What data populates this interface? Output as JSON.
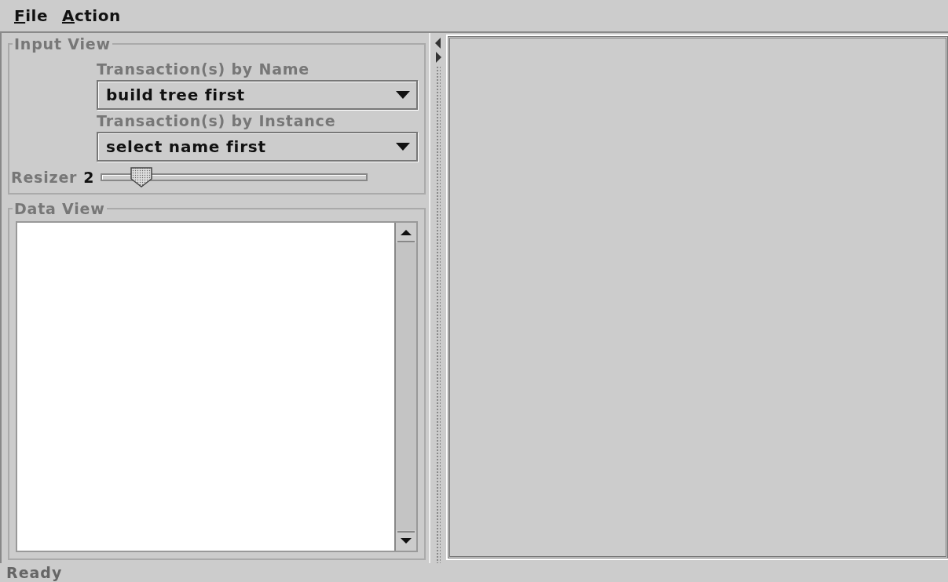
{
  "menu_bar": {
    "items": [
      {
        "label": "File"
      },
      {
        "label": "Action"
      }
    ]
  },
  "input_view": {
    "title": "Input View",
    "combos": [
      {
        "label": "Transaction(s) by Name",
        "value": "build tree first"
      },
      {
        "label": "Transaction(s) by Instance",
        "value": "select name first"
      }
    ],
    "slider": {
      "label": "Resizer",
      "reading": "2",
      "level": 0.12
    }
  },
  "data_view": {
    "title": "Data View"
  },
  "status_bar": {
    "text": "Ready"
  }
}
